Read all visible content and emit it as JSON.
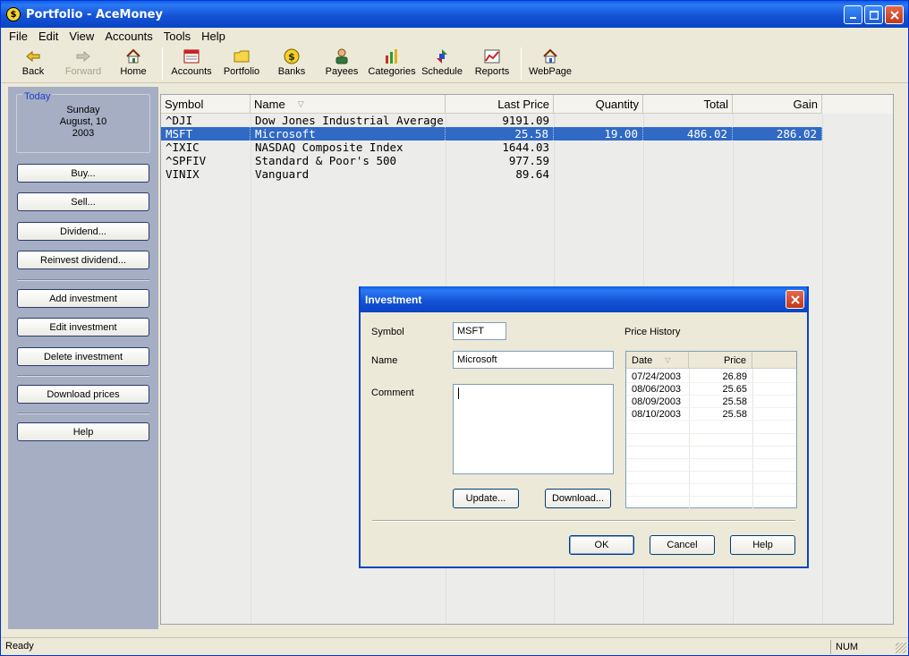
{
  "window": {
    "title": "Portfolio - AceMoney",
    "app_icon": "$"
  },
  "menu": [
    "File",
    "Edit",
    "View",
    "Accounts",
    "Tools",
    "Help"
  ],
  "toolbar": {
    "back": "Back",
    "forward": "Forward",
    "home": "Home",
    "accounts": "Accounts",
    "portfolio": "Portfolio",
    "banks": "Banks",
    "payees": "Payees",
    "categories": "Categories",
    "schedule": "Schedule",
    "reports": "Reports",
    "webpage": "WebPage"
  },
  "sidebar": {
    "today_label": "Today",
    "day": "Sunday",
    "date": "August, 10",
    "year": "2003",
    "buttons": {
      "buy": "Buy...",
      "sell": "Sell...",
      "dividend": "Dividend...",
      "reinvest": "Reinvest dividend...",
      "add": "Add investment",
      "edit": "Edit investment",
      "delete": "Delete investment",
      "download": "Download prices",
      "help": "Help"
    }
  },
  "table": {
    "headers": {
      "symbol": "Symbol",
      "name": "Name",
      "last_price": "Last Price",
      "quantity": "Quantity",
      "total": "Total",
      "gain": "Gain"
    },
    "rows": [
      {
        "symbol": "^DJI",
        "name": "Dow Jones Industrial Average",
        "last_price": "9191.09",
        "quantity": "",
        "total": "",
        "gain": ""
      },
      {
        "symbol": "MSFT",
        "name": "Microsoft",
        "last_price": "25.58",
        "quantity": "19.00",
        "total": "486.02",
        "gain": "286.02"
      },
      {
        "symbol": "^IXIC",
        "name": "NASDAQ Composite Index",
        "last_price": "1644.03",
        "quantity": "",
        "total": "",
        "gain": ""
      },
      {
        "symbol": "^SPFIV",
        "name": "Standard & Poor's 500",
        "last_price": "977.59",
        "quantity": "",
        "total": "",
        "gain": ""
      },
      {
        "symbol": "VINIX",
        "name": "Vanguard",
        "last_price": "89.64",
        "quantity": "",
        "total": "",
        "gain": ""
      }
    ],
    "selected_row": 1
  },
  "dialog": {
    "title": "Investment",
    "symbol_label": "Symbol",
    "symbol_value": "MSFT",
    "name_label": "Name",
    "name_value": "Microsoft",
    "comment_label": "Comment",
    "comment_value": "",
    "price_history_label": "Price History",
    "ph_headers": {
      "date": "Date",
      "price": "Price"
    },
    "price_history": [
      {
        "date": "07/24/2003",
        "price": "26.89"
      },
      {
        "date": "08/06/2003",
        "price": "25.65"
      },
      {
        "date": "08/09/2003",
        "price": "25.58"
      },
      {
        "date": "08/10/2003",
        "price": "25.58"
      }
    ],
    "update_button": "Update...",
    "download_button": "Download...",
    "ok_button": "OK",
    "cancel_button": "Cancel",
    "help_button": "Help"
  },
  "status": {
    "text": "Ready",
    "num": "NUM"
  }
}
